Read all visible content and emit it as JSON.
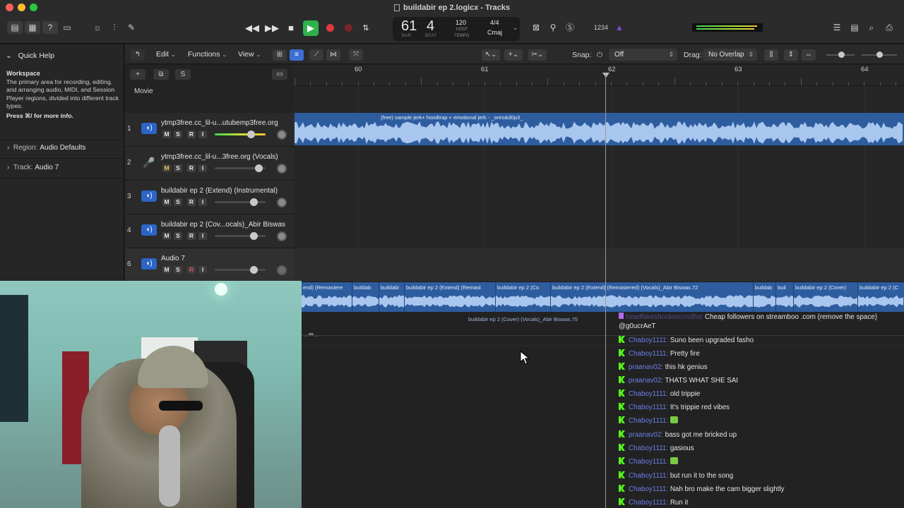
{
  "window": {
    "title": "buildabir ep 2.logicx - Tracks"
  },
  "lcd": {
    "bar": "61",
    "beat": "4",
    "bar_label": "BAR",
    "beat_label": "BEAT",
    "tempo": "120",
    "keep_label": "KEEP",
    "tempo_label": "TEMPO",
    "time_sig": "4/4",
    "key": "Cmaj",
    "count_in": "1234"
  },
  "inspector": {
    "quick_help_label": "Quick Help",
    "title": "Workspace",
    "body": "The primary area for recording, editing, and arranging audio, MIDI, and Session Player regions, divided into different track types.",
    "footer": "Press ⌘/ for more info.",
    "region_label": "Region:",
    "region_value": "Audio Defaults",
    "track_label": "Track:",
    "track_value": "Audio 7"
  },
  "toolbar": {
    "edit": "Edit",
    "functions": "Functions",
    "view": "View",
    "snap_label": "Snap:",
    "snap_value": "Off",
    "drag_label": "Drag:",
    "drag_value": "No Overlap"
  },
  "tracks_header": {
    "movie": "Movie",
    "add": "+",
    "s": "S"
  },
  "tracks": [
    {
      "num": "1",
      "name": "ytmp3free.cc_lil-u...utubemp3free.org"
    },
    {
      "num": "2",
      "name": "ytmp3free.cc_lil-u...3free.org (Vocals)"
    },
    {
      "num": "3",
      "name": "buildabir ep 2 (Extend) (Instrumental)"
    },
    {
      "num": "4",
      "name": "buildabir ep 2 (Cov...ocals)_Abir Biswas"
    },
    {
      "num": "6",
      "name": "Audio 7"
    }
  ],
  "msri": {
    "m": "M",
    "s": "S",
    "r": "R",
    "i": "I"
  },
  "ruler": {
    "b60": "60",
    "b61": "61",
    "b62": "62",
    "b63": "63",
    "b64": "64"
  },
  "regions": {
    "track1": "(free) sample jerk+ hoodtrap + emotional jerk - _oreo&d0p3_",
    "strip": [
      "end) (Remastere",
      "buildab",
      "buildabi",
      "buildabir ep 2 (Extend) (Remast",
      "buildabir ep 2 (Co",
      "buildabir ep 2 (Extend) (Remastered) (Vocals)_Abir Biswas.72",
      "buildab",
      "buil",
      "buildabir ep 2 (Cover)",
      "buildabir ep 2 (C"
    ],
    "sub": "buildabir ep 2 (Cover) (Vocals)_Abir Biswas.75"
  },
  "chat": [
    {
      "user": "headfakeshockercrnoffoc",
      "text": "Cheap followers on streamboo .com (remove the space)",
      "kind": "spam"
    },
    {
      "user": "",
      "text": "@g0ucrAeT",
      "kind": "cont"
    },
    {
      "user": "Chaboy1111:",
      "text": "Suno been upgraded fasho"
    },
    {
      "user": "Chaboy1111:",
      "text": "Pretty fire"
    },
    {
      "user": "praanav02:",
      "text": "this hk genius"
    },
    {
      "user": "praanav02:",
      "text": "THATS WHAT SHE SAI"
    },
    {
      "user": "Chaboy1111:",
      "text": "old trippie"
    },
    {
      "user": "Chaboy1111:",
      "text": "It's trippie red vibes"
    },
    {
      "user": "Chaboy1111:",
      "text": "",
      "emote": true
    },
    {
      "user": "praanav02:",
      "text": "bass got me bricked up"
    },
    {
      "user": "Chaboy1111:",
      "text": "gasious"
    },
    {
      "user": "Chaboy1111:",
      "text": "",
      "emote": true
    },
    {
      "user": "Chaboy1111:",
      "text": "but run it to the song"
    },
    {
      "user": "Chaboy1111:",
      "text": "Nah bro make the cam bigger slightly"
    },
    {
      "user": "Chaboy1111:",
      "text": "Run it"
    }
  ]
}
